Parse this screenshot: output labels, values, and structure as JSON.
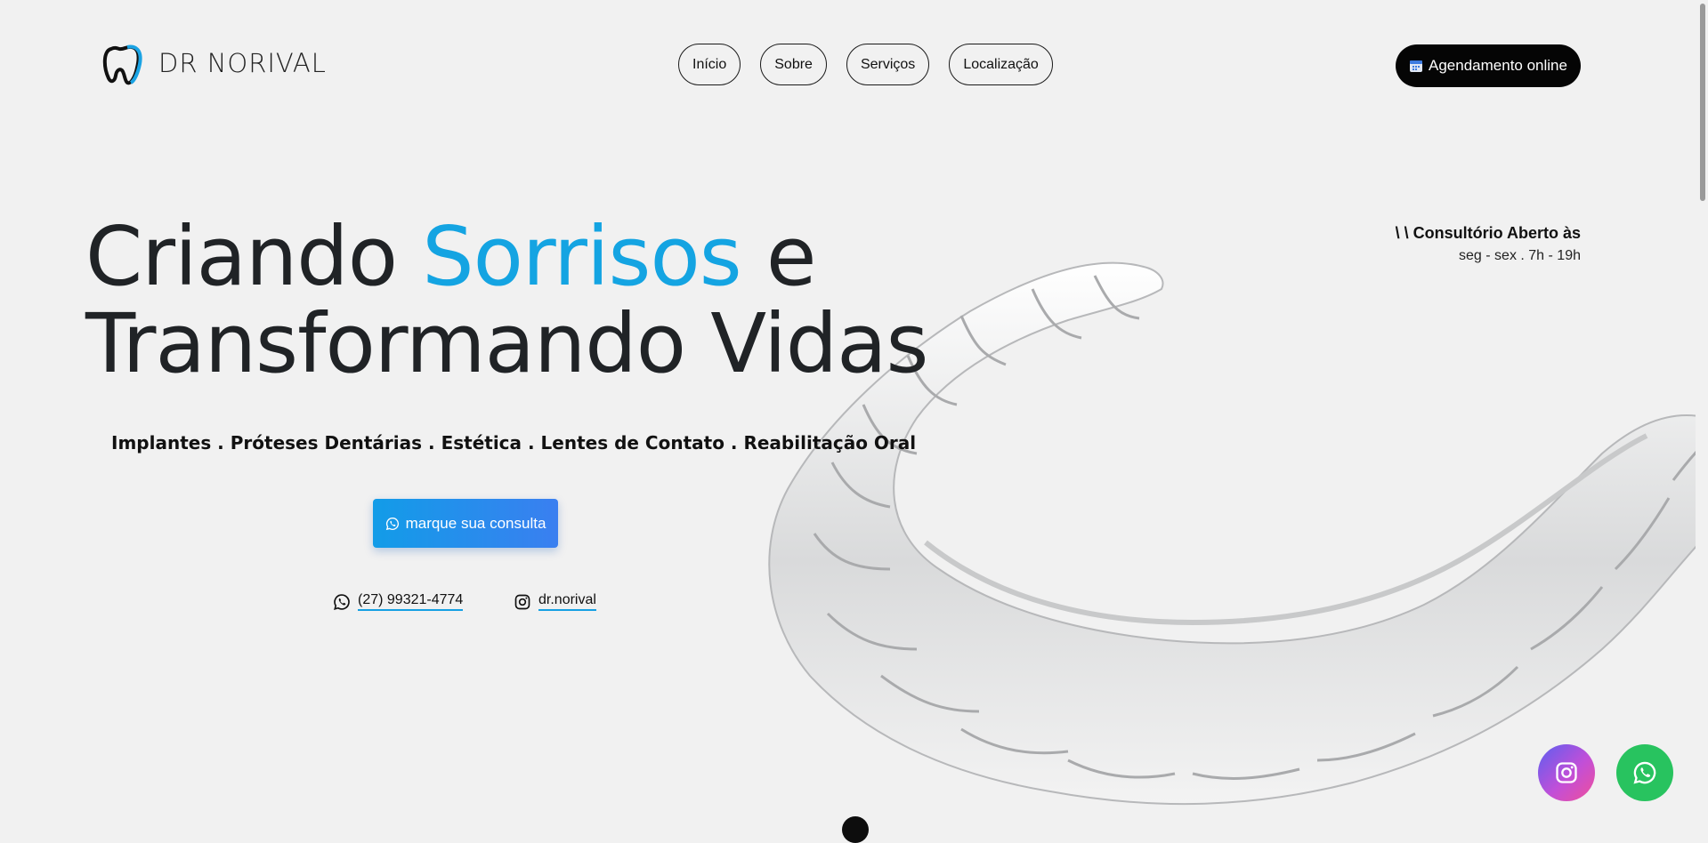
{
  "header": {
    "logo_text": "DR NORIVAL",
    "nav": [
      {
        "label": "Início"
      },
      {
        "label": "Sobre"
      },
      {
        "label": "Serviços"
      },
      {
        "label": "Localização"
      }
    ],
    "cta_label": "Agendamento online"
  },
  "hero": {
    "title_part1": "Criando ",
    "title_accent": "Sorrisos",
    "title_part2": " e",
    "title_line2": "Transformando Vidas",
    "subtitle": "Implantes . Próteses Dentárias . Estética . Lentes de Contato . Reabilitação Oral",
    "consult_button": "marque sua consulta",
    "phone": "(27) 99321-4774",
    "instagram": "dr.norival"
  },
  "hours": {
    "title": "\\ \\ Consultório Aberto às",
    "text": "seg - sex . 7h - 19h"
  },
  "icons": {
    "logo": "tooth-logo-icon",
    "calendar": "calendar-icon",
    "whatsapp": "whatsapp-icon",
    "instagram": "instagram-icon"
  },
  "colors": {
    "accent": "#14a4e2",
    "cta_dark": "#050505",
    "whatsapp": "#28c35f",
    "background": "#f1f1f1"
  }
}
